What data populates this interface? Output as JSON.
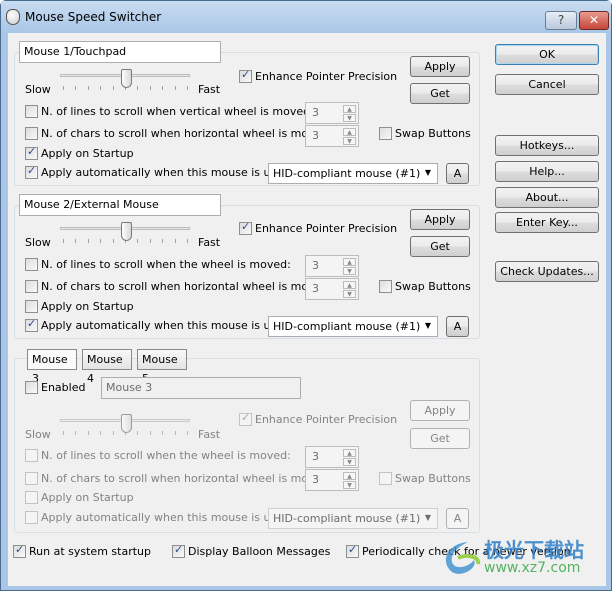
{
  "window": {
    "title": "Mouse Speed Switcher",
    "help_label": "?",
    "close_label": "✕"
  },
  "mouse1": {
    "name": "Mouse 1/Touchpad",
    "slow_label": "Slow",
    "fast_label": "Fast",
    "speed_percent": 50,
    "enhance_label": "Enhance Pointer Precision",
    "enhance_checked": true,
    "apply_label": "Apply",
    "get_label": "Get",
    "lines_label": "N. of lines to scroll when vertical wheel is moved:",
    "lines_checked": false,
    "lines_value": "3",
    "chars_label": "N. of chars to scroll when  horizontal wheel is moved:",
    "chars_checked": false,
    "chars_value": "3",
    "swap_label": "Swap Buttons",
    "swap_checked": false,
    "startup_label": "Apply on Startup",
    "startup_checked": true,
    "auto_label": "Apply automatically when this mouse is used:",
    "auto_checked": true,
    "device": "HID-compliant mouse (#1)",
    "a_label": "A"
  },
  "mouse2": {
    "name": "Mouse 2/External Mouse",
    "slow_label": "Slow",
    "fast_label": "Fast",
    "speed_percent": 50,
    "enhance_label": "Enhance Pointer Precision",
    "enhance_checked": true,
    "apply_label": "Apply",
    "get_label": "Get",
    "lines_label": "N. of lines to scroll when the wheel is moved:",
    "lines_checked": false,
    "lines_value": "3",
    "chars_label": "N. of chars to scroll when  horizontal wheel is moved:",
    "chars_checked": false,
    "chars_value": "3",
    "swap_label": "Swap Buttons",
    "swap_checked": false,
    "startup_label": "Apply on Startup",
    "startup_checked": false,
    "auto_label": "Apply automatically when this mouse is used:",
    "auto_checked": true,
    "device": "HID-compliant mouse (#1)",
    "a_label": "A"
  },
  "mouse_extra": {
    "tabs": [
      "Mouse 3",
      "Mouse 4",
      "Mouse 5"
    ],
    "selected_tab": "Mouse 3",
    "enabled_label": "Enabled",
    "enabled_checked": false,
    "name": "Mouse 3",
    "slow_label": "Slow",
    "fast_label": "Fast",
    "speed_percent": 50,
    "enhance_label": "Enhance Pointer Precision",
    "enhance_checked": true,
    "apply_label": "Apply",
    "get_label": "Get",
    "lines_label": "N. of lines to scroll when the wheel is moved:",
    "lines_value": "3",
    "chars_label": "N. of chars to scroll when  horizontal wheel is moved:",
    "chars_value": "3",
    "swap_label": "Swap Buttons",
    "startup_label": "Apply on Startup",
    "auto_label": "Apply automatically when this mouse is used:",
    "device": "HID-compliant mouse (#1)",
    "a_label": "A"
  },
  "side_buttons": {
    "ok": "OK",
    "cancel": "Cancel",
    "hotkeys": "Hotkeys...",
    "help": "Help...",
    "about": "About...",
    "enter_key": "Enter Key...",
    "check_updates": "Check Updates..."
  },
  "footer": {
    "run_startup": "Run at system startup",
    "run_startup_checked": true,
    "balloon": "Display Balloon Messages",
    "balloon_checked": true,
    "check_version": "Periodically check for a newer version",
    "check_version_checked": true
  },
  "watermark": {
    "text": "极光下载站",
    "url": "www.xz7.com"
  }
}
